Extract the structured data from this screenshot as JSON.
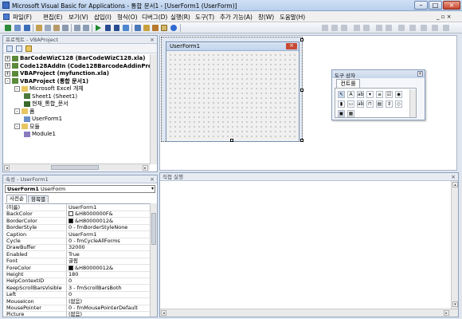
{
  "window": {
    "title": "Microsoft Visual Basic for Applications - 통합 문서1 - [UserForm1 (UserForm)]"
  },
  "menu": {
    "items": [
      "파일(F)",
      "편집(E)",
      "보기(V)",
      "삽입(I)",
      "형식(O)",
      "디버그(D)",
      "실행(R)",
      "도구(T)",
      "추가 기능(A)",
      "창(W)",
      "도움말(H)"
    ]
  },
  "project": {
    "title": "프로젝트 - VBAProject",
    "rows": [
      {
        "label": "BarCodeWizC128 (BarCodeWizC128.xla)",
        "bold": true,
        "toggle": "+",
        "icon": "vba-project-icon"
      },
      {
        "label": "Code128AddIn (Code128BarcodeAddinPrepende",
        "bold": true,
        "toggle": "+",
        "icon": "vba-project-icon"
      },
      {
        "label": "VBAProject (myfunction.xla)",
        "bold": true,
        "toggle": "+",
        "icon": "vba-project-icon"
      },
      {
        "label": "VBAProject (통합 문서1)",
        "bold": true,
        "toggle": "-",
        "icon": "vba-project-icon"
      },
      {
        "label": "Microsoft Excel 개체",
        "bold": false,
        "toggle": "-",
        "icon": "folder-icon"
      },
      {
        "label": "Sheet1 (Sheet1)",
        "bold": false,
        "toggle": "",
        "icon": "sheet-icon"
      },
      {
        "label": "현재_통합_문서",
        "bold": false,
        "toggle": "",
        "icon": "workbook-icon"
      },
      {
        "label": "폼",
        "bold": false,
        "toggle": "-",
        "icon": "folder-icon"
      },
      {
        "label": "UserForm1",
        "bold": false,
        "toggle": "",
        "icon": "form-icon"
      },
      {
        "label": "모듈",
        "bold": false,
        "toggle": "-",
        "icon": "folder-icon"
      },
      {
        "label": "Module1",
        "bold": false,
        "toggle": "",
        "icon": "module-icon"
      }
    ]
  },
  "properties": {
    "title": "속성 - UserForm1",
    "object_name": "UserForm1",
    "object_type": "UserForm",
    "tab_alpha": "사전순",
    "tab_category": "항목별",
    "rows": [
      {
        "name": "(이름)",
        "value": "UserForm1"
      },
      {
        "name": "BackColor",
        "value": "&H8000000F&",
        "swatch": "#ffffff"
      },
      {
        "name": "BorderColor",
        "value": "&H80000012&",
        "swatch": "#000000"
      },
      {
        "name": "BorderStyle",
        "value": "0 - fmBorderStyleNone"
      },
      {
        "name": "Caption",
        "value": "UserForm1"
      },
      {
        "name": "Cycle",
        "value": "0 - fmCycleAllForms"
      },
      {
        "name": "DrawBuffer",
        "value": "32000"
      },
      {
        "name": "Enabled",
        "value": "True"
      },
      {
        "name": "Font",
        "value": "굴림"
      },
      {
        "name": "ForeColor",
        "value": "&H80000012&",
        "swatch": "#000000"
      },
      {
        "name": "Height",
        "value": "180"
      },
      {
        "name": "HelpContextID",
        "value": "0"
      },
      {
        "name": "KeepScrollBarsVisible",
        "value": "3 - fmScrollBarsBoth"
      },
      {
        "name": "Left",
        "value": "0"
      },
      {
        "name": "MouseIcon",
        "value": "(없음)"
      },
      {
        "name": "MousePointer",
        "value": "0 - fmMousePointerDefault"
      },
      {
        "name": "Picture",
        "value": "(없음)"
      }
    ]
  },
  "designer": {
    "form_caption": "UserForm1"
  },
  "toolbox": {
    "title": "도구 상자",
    "tab": "컨트롤"
  },
  "immediate": {
    "title": "직접 실행"
  }
}
